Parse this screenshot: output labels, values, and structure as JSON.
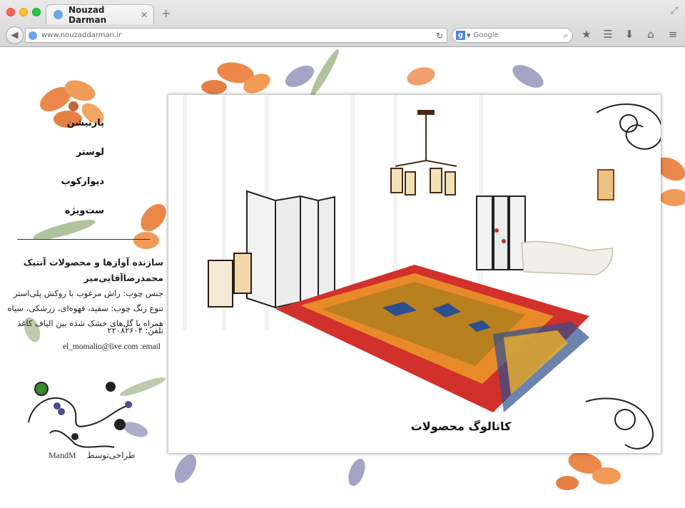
{
  "browser": {
    "tab_title": "Nouzad Darman",
    "tab_close": "✕",
    "new_tab": "+",
    "url": "www.nouzaddarman.ir",
    "search_engine_letter": "g",
    "search_placeholder": "Google",
    "icons": [
      "back-icon",
      "reload-icon",
      "search-icon",
      "bookmark-star-icon",
      "reading-list-icon",
      "download-icon",
      "home-icon",
      "menu-icon",
      "restore-icon"
    ]
  },
  "sidebar": {
    "menu": [
      "پارتیشن",
      "لوستر",
      "دیوارکوب",
      "ست‌ویژه"
    ]
  },
  "info": {
    "title": "سازنده آوازها و محصولات آنتیک",
    "name": "محمدرضاآقایی‌میر",
    "line1": "جنس چوب: راش مرغوب با روکش پلی‌استر",
    "line2": "تنوع رنگ چوب: سفید، قهوه‌ای، زرشکی، سیاه",
    "line3": "همراه با گل‌های خشک شده بین الیاف کاغذ",
    "phone": "تلفن: ۲۲۰۸۲۶۰۴",
    "email": "el_momalio@live.com :email"
  },
  "credit": {
    "designer_label": "طراحی‌توسط",
    "designer_name": "MandM"
  },
  "main": {
    "catalog_link": "کاتالوگ محصولات"
  },
  "colors": {
    "flower_orange": "#e8732a",
    "leaf_green": "#7a9a5a",
    "petal_purple": "#4b4f8a",
    "rug_red": "#d2302a",
    "rug_orange": "#e88a2a",
    "rug_blue": "#2e4f8f"
  }
}
